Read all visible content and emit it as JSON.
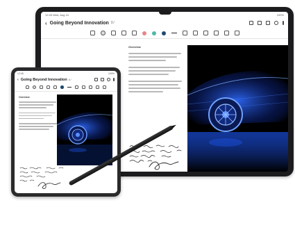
{
  "tablet": {
    "status": {
      "left": "12:45  Wed, Aug 10",
      "right": "100%"
    },
    "header": {
      "back": "‹",
      "title": "Going Beyond Innovation",
      "count": "0 ⁄"
    },
    "note_heading": "Overview"
  },
  "phone": {
    "status": {
      "left": "12:45",
      "right": "100%"
    },
    "header": {
      "back": "‹",
      "title": "Going Beyond Innovation",
      "count": "0 ⁄"
    },
    "note_heading": "Overview"
  },
  "colors": {
    "pen_dot_1": "#e98585",
    "pen_dot_2": "#4fb8a8",
    "pen_dot_3": "#1e4a72",
    "car_glow": "#1f5bff"
  }
}
